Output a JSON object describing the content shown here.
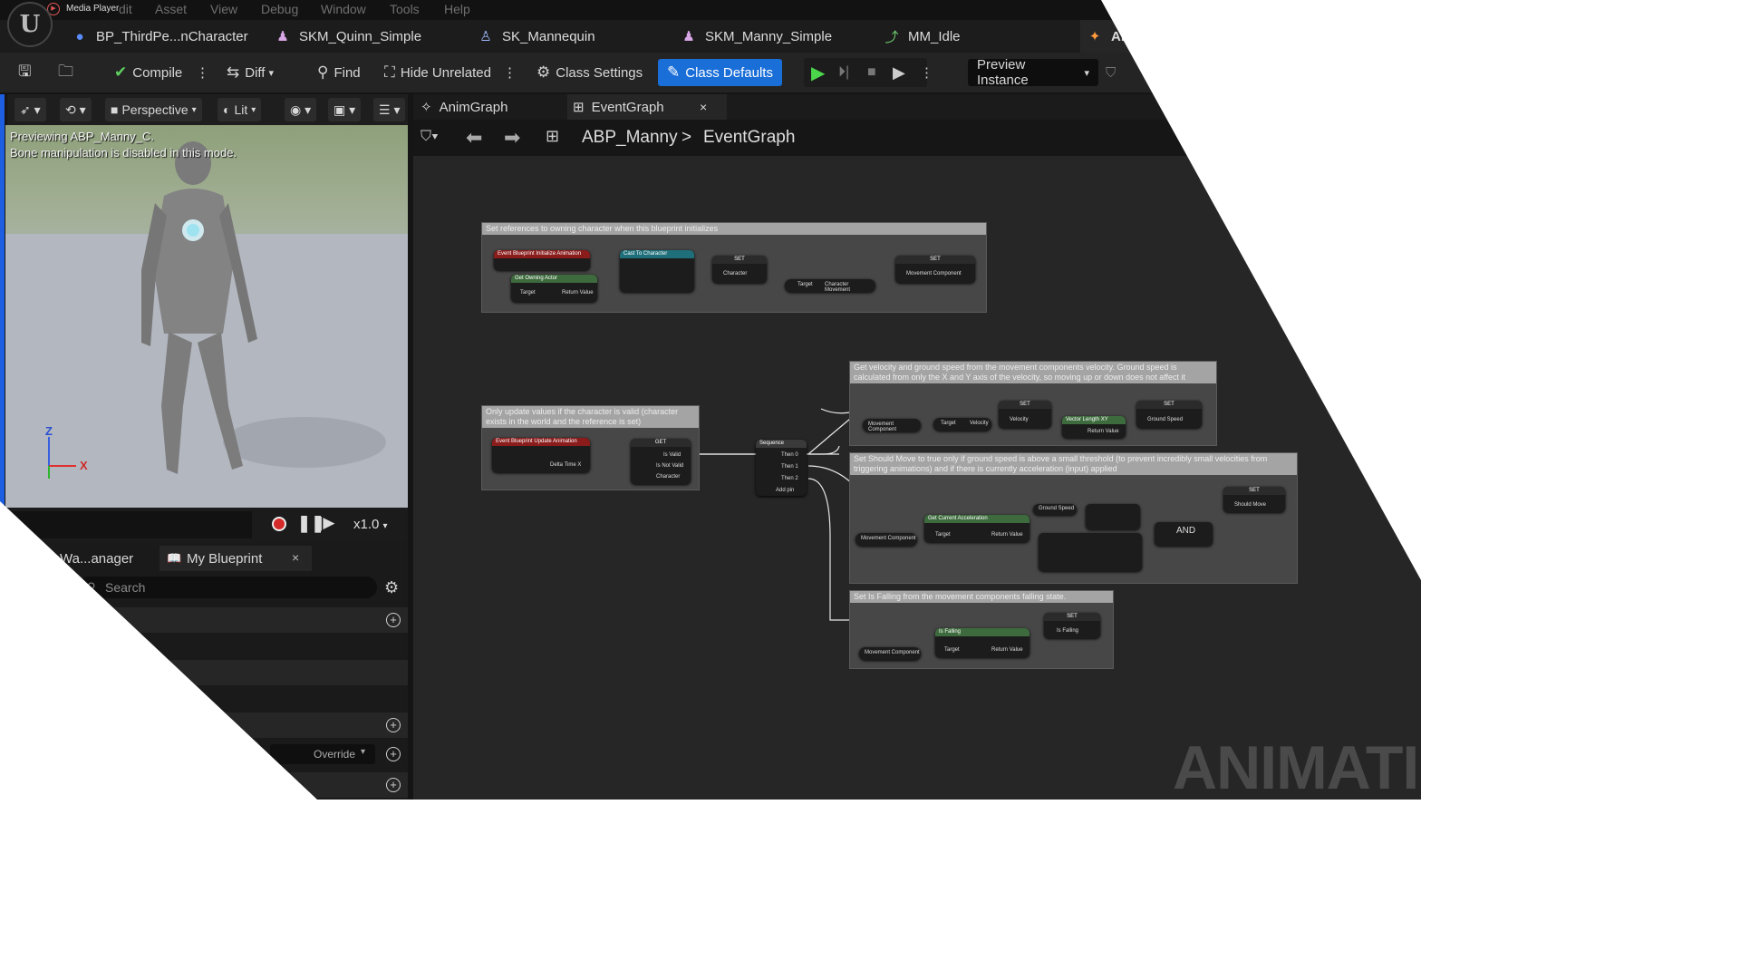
{
  "menubar": {
    "app_label": "Media Player",
    "items": [
      "dit",
      "Asset",
      "View",
      "Debug",
      "Window",
      "Tools",
      "Help"
    ]
  },
  "tabs": [
    {
      "label": "BP_ThirdPe...nCharacter",
      "icon": "person-icon"
    },
    {
      "label": "SKM_Quinn_Simple",
      "icon": "skeletal-mesh-icon"
    },
    {
      "label": "SK_Mannequin",
      "icon": "skeleton-icon"
    },
    {
      "label": "SKM_Manny_Simple",
      "icon": "skeletal-mesh-icon"
    },
    {
      "label": "MM_Idle",
      "icon": "animation-icon"
    },
    {
      "label": "ABP_M",
      "icon": "anim-blueprint-icon"
    }
  ],
  "toolbar": {
    "compile": "Compile",
    "diff": "Diff",
    "find": "Find",
    "hide_unrelated": "Hide Unrelated",
    "class_settings": "Class Settings",
    "class_defaults": "Class Defaults",
    "preview_instance": "Preview Instance"
  },
  "viewport": {
    "perspective": "Perspective",
    "lit": "Lit",
    "preview_line1": "Previewing ABP_Manny_C.",
    "preview_line2": "Bone manipulation is disabled in this mode.",
    "axis_z": "Z",
    "axis_x": "X",
    "speed": "x1.0"
  },
  "bottom_panel": {
    "tab1": "Wa...anager",
    "tab2": "My Blueprint",
    "search_placeholder": "Search",
    "override": "Override"
  },
  "graph": {
    "tab_animgraph": "AnimGraph",
    "tab_eventgraph": "EventGraph",
    "breadcrumb_root": "ABP_Manny",
    "breadcrumb_sep": ">",
    "breadcrumb_leaf": "EventGraph",
    "comments": [
      "Set references to owning character when this blueprint initializes",
      "Get velocity and ground speed from the movement components velocity. Ground speed is calculated from only the X and Y axis of the velocity, so moving up or down does not affect it",
      "Only update values if the character is valid (character exists in the world and the reference is set)",
      "Set Should Move to true only if ground speed is above a small threshold (to prevent incredibly small velocities from triggering animations) and if there is currently acceleration (input) applied",
      "Set Is Falling from the movement components falling state."
    ],
    "nodes": {
      "init_event": "Event Blueprint Initialize Animation",
      "get_owning_actor": "Get Owning Actor",
      "cast": "Cast To Character",
      "set1": "SET",
      "set2": "SET",
      "character_pin": "Character",
      "movement_pin": "Movement Component",
      "target_pin": "Target",
      "char_movement": "Character Movement",
      "update_event": "Event Blueprint Update Animation",
      "delta": "Delta Time X",
      "get": "GET",
      "is_valid": "Is Valid",
      "is_not_valid": "Is Not Valid",
      "sequence": "Sequence",
      "then0": "Then 0",
      "then1": "Then 1",
      "then2": "Then 2",
      "add_pin": "Add pin",
      "velocity": "Velocity",
      "vector_length": "Vector Length XY",
      "ground_speed": "Ground Speed",
      "get_accel": "Get Current Acceleration",
      "should_move": "Should Move",
      "and": "AND",
      "is_falling_fn": "Is Falling",
      "is_falling": "Is Falling",
      "return_value": "Return Value"
    }
  },
  "watermark": "ANIMATIO"
}
